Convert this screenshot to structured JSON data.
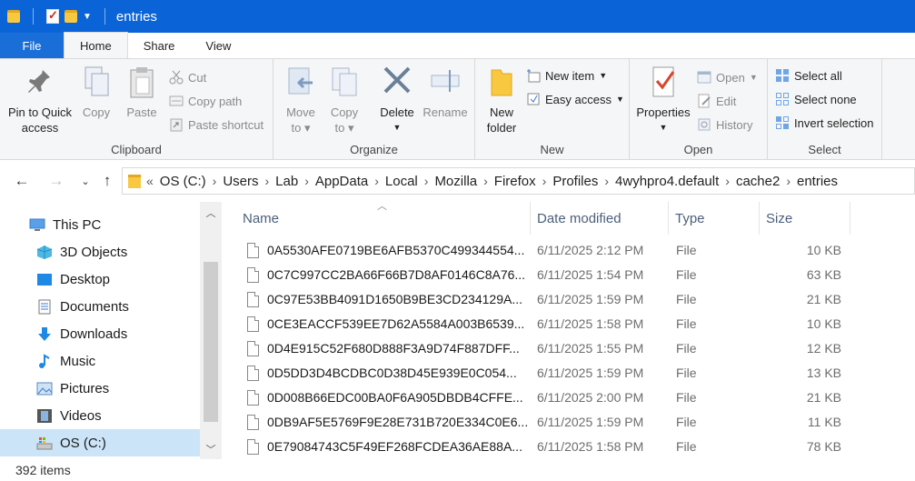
{
  "window": {
    "title": "entries"
  },
  "tabs": [
    "File",
    "Home",
    "Share",
    "View"
  ],
  "ribbon": {
    "clipboard": {
      "label": "Clipboard",
      "pin_line1": "Pin to Quick",
      "pin_line2": "access",
      "copy": "Copy",
      "paste": "Paste",
      "cut": "Cut",
      "copy_path": "Copy path",
      "paste_shortcut": "Paste shortcut"
    },
    "organize": {
      "label": "Organize",
      "move_to_1": "Move",
      "move_to_2": "to",
      "copy_to_1": "Copy",
      "copy_to_2": "to",
      "delete": "Delete",
      "rename": "Rename"
    },
    "new": {
      "label": "New",
      "new_folder_1": "New",
      "new_folder_2": "folder",
      "new_item": "New item",
      "easy_access": "Easy access"
    },
    "open": {
      "label": "Open",
      "properties": "Properties",
      "open": "Open",
      "edit": "Edit",
      "history": "History"
    },
    "select": {
      "label": "Select",
      "select_all": "Select all",
      "select_none": "Select none",
      "invert_selection": "Invert selection"
    }
  },
  "address": {
    "overflow": "«",
    "crumbs": [
      "OS (C:)",
      "Users",
      "Lab",
      "AppData",
      "Local",
      "Mozilla",
      "Firefox",
      "Profiles",
      "4wyhpro4.default",
      "cache2",
      "entries"
    ]
  },
  "nav_pane": {
    "items": [
      "This PC",
      "3D Objects",
      "Desktop",
      "Documents",
      "Downloads",
      "Music",
      "Pictures",
      "Videos",
      "OS (C:)"
    ]
  },
  "columns": {
    "name": "Name",
    "date": "Date modified",
    "type": "Type",
    "size": "Size"
  },
  "files": [
    {
      "name": "0A5530AFE0719BE6AFB5370C499344554...",
      "date": "6/11/2025 2:12 PM",
      "type": "File",
      "size": "10 KB"
    },
    {
      "name": "0C7C997CC2BA66F66B7D8AF0146C8A76...",
      "date": "6/11/2025 1:54 PM",
      "type": "File",
      "size": "63 KB"
    },
    {
      "name": "0C97E53BB4091D1650B9BE3CD234129A...",
      "date": "6/11/2025 1:59 PM",
      "type": "File",
      "size": "21 KB"
    },
    {
      "name": "0CE3EACCF539EE7D62A5584A003B6539...",
      "date": "6/11/2025 1:58 PM",
      "type": "File",
      "size": "10 KB"
    },
    {
      "name": "0D4E915C52F680D888F3A9D74F887DFF...",
      "date": "6/11/2025 1:55 PM",
      "type": "File",
      "size": "12 KB"
    },
    {
      "name": "0D5DD3D4BCDBC0D38D45E939E0C054...",
      "date": "6/11/2025 1:59 PM",
      "type": "File",
      "size": "13 KB"
    },
    {
      "name": "0D008B66EDC00BA0F6A905DBDB4CFFE...",
      "date": "6/11/2025 2:00 PM",
      "type": "File",
      "size": "21 KB"
    },
    {
      "name": "0DB9AF5E5769F9E28E731B720E334C0E6...",
      "date": "6/11/2025 1:59 PM",
      "type": "File",
      "size": "11 KB"
    },
    {
      "name": "0E79084743C5F49EF268FCDEA36AE88A...",
      "date": "6/11/2025 1:58 PM",
      "type": "File",
      "size": "78 KB"
    }
  ],
  "status": {
    "item_count": "392 items"
  }
}
